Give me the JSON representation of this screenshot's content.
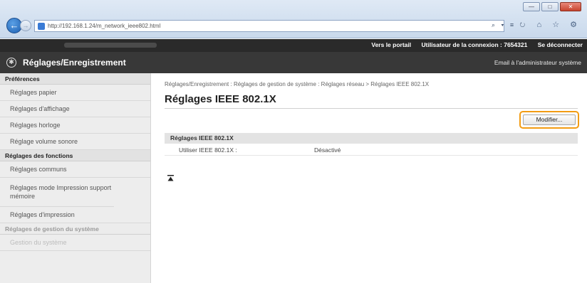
{
  "browser": {
    "url": "http://192.168.1.24/m_network_ieee802.html",
    "min": "—",
    "max": "□",
    "close": "✕",
    "addr_tools": "⌕ ▾ ≡ ↻",
    "toolbar_icons": "⌂ ☆ ⚙"
  },
  "header": {
    "portal_link": "Vers le portail",
    "user_label": "Utilisateur de la connexion : 7654321",
    "logout_link": "Se déconnecter",
    "app_title": "Réglages/Enregistrement",
    "mail_link": "Email à l'administrateur système"
  },
  "sidebar": {
    "sections": [
      {
        "heading": "Préférences",
        "items": [
          "Réglages papier",
          "Réglages d'affichage",
          "Réglages horloge",
          "Réglage volume sonore"
        ]
      },
      {
        "heading": "Réglages des fonctions",
        "items": [
          "Réglages communs",
          "Réglages mode Impression support mémoire",
          "Réglages d'impression"
        ]
      },
      {
        "heading": "Réglages de gestion du système",
        "items": [
          "Gestion du système"
        ]
      }
    ]
  },
  "main": {
    "breadcrumb": "Réglages/Enregistrement : Réglages de gestion de système : Réglages réseau > Réglages IEEE 802.1X",
    "title": "Réglages IEEE 802.1X",
    "modify_label": "Modifier...",
    "section_title": "Réglages IEEE 802.1X",
    "rows": [
      {
        "label": "Utiliser IEEE 802.1X :",
        "value": "Désactivé"
      }
    ]
  },
  "colors": {
    "accent_highlight": "#f39c12",
    "header_dark": "#2a2a2a",
    "title_bar": "#383838"
  }
}
